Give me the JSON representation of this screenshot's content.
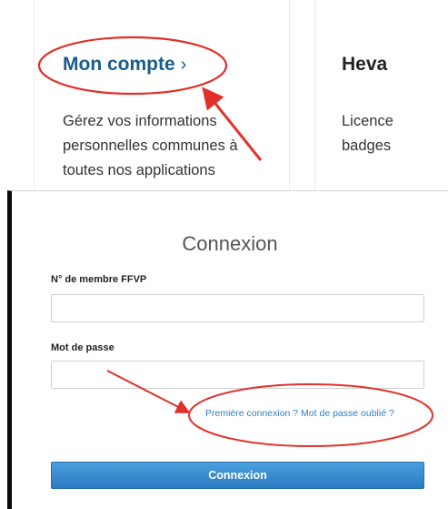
{
  "top_cards": {
    "account": {
      "title": "Mon compte",
      "chevron": "›",
      "description": [
        "Gérez vos informations",
        "personnelles communes à",
        "toutes nos applications"
      ]
    },
    "heva": {
      "title": "Heva",
      "description": [
        "Licence",
        "badges"
      ]
    }
  },
  "login": {
    "heading": "Connexion",
    "member_label": "N° de membre FFVP",
    "member_value": "",
    "password_label": "Mot de passe",
    "password_value": "",
    "first_login_link": "Première connexion ?",
    "forgot_password_link": "Mot de passe oublié ?",
    "submit_label": "Connexion"
  },
  "colors": {
    "brand_blue": "#1a5c8e",
    "button_blue": "#2f86cc",
    "link_blue": "#2f7fbf",
    "annotation_red": "#e0312b"
  }
}
